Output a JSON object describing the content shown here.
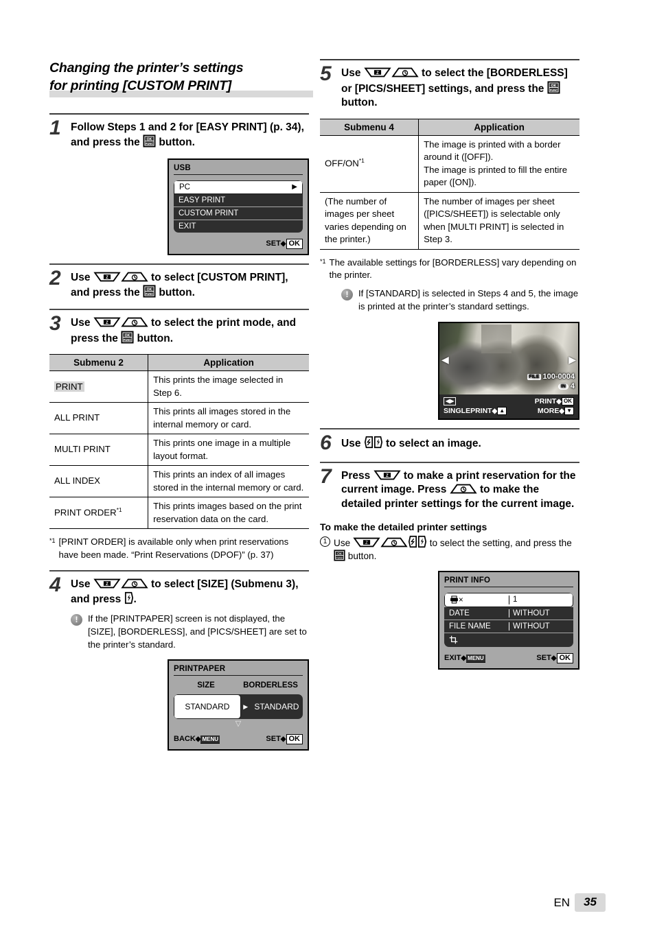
{
  "heading": {
    "line1": "Changing the printer’s settings",
    "line2": "for printing [CUSTOM PRINT]"
  },
  "steps": {
    "s1": {
      "num": "1",
      "text_a": "Follow Steps 1 and 2 for [EASY PRINT] (p. 34), and press the ",
      "text_b": " button."
    },
    "s2": {
      "num": "2",
      "text_a": "Use ",
      "text_b": " to select [CUSTOM PRINT], and press the ",
      "text_c": " button."
    },
    "s3": {
      "num": "3",
      "text_a": "Use ",
      "text_b": " to select the print mode, and press the ",
      "text_c": " button."
    },
    "s4": {
      "num": "4",
      "text_a": "Use ",
      "text_b": " to select [SIZE] (Submenu 3), and press ",
      "text_c": "."
    },
    "s5": {
      "num": "5",
      "text_a": "Use ",
      "text_b": " to select the [BORDERLESS] or [PICS/SHEET] settings, and press the ",
      "text_c": " button."
    },
    "s6": {
      "num": "6",
      "text_a": "Use ",
      "text_b": " to select an image."
    },
    "s7": {
      "num": "7",
      "text_a": "Press ",
      "text_b": " to make a print reservation for the current image. Press ",
      "text_c": " to make the detailed printer settings for the current image."
    }
  },
  "notes": {
    "step4_note": "If the [PRINTPAPER] screen is not displayed, the [SIZE], [BORDERLESS], and [PICS/SHEET] are set to the printer’s standard.",
    "step5_note": "If [STANDARD] is selected in Steps 4 and 5, the image is printed at the printer’s standard settings.",
    "bang_glyph": "!"
  },
  "footnotes": {
    "left": {
      "mark": "*1",
      "text": "[PRINT ORDER] is available only when print reservations have been made. “Print Reservations (DPOF)” (p. 37)"
    },
    "right": {
      "mark": "*1",
      "text": "The available settings for [BORDERLESS] vary depending on the printer."
    }
  },
  "table_submenu2": {
    "headers": [
      "Submenu 2",
      "Application"
    ],
    "rows": [
      {
        "name": "PRINT",
        "highlight": true,
        "app": "This prints the image selected in Step 6."
      },
      {
        "name": "ALL PRINT",
        "highlight": false,
        "app": "This prints all images stored in the internal memory or card."
      },
      {
        "name": "MULTI PRINT",
        "highlight": false,
        "app": "This prints one image in a multiple layout format."
      },
      {
        "name": "ALL INDEX",
        "highlight": false,
        "app": "This prints an index of all images stored in the internal memory or card."
      },
      {
        "name": "PRINT ORDER",
        "sup": "*1",
        "highlight": false,
        "app": "This prints images based on the print reservation data on the card."
      }
    ]
  },
  "table_submenu4": {
    "headers": [
      "Submenu 4",
      "Application"
    ],
    "rows": [
      {
        "name": "OFF/ON",
        "sup": "*1",
        "app": "The image is printed with a border around it ([OFF]).\nThe image is printed to fill the entire paper ([ON])."
      },
      {
        "name": "(The number of images per sheet varies depending on the printer.)",
        "app": "The number of images per sheet ([PICS/SHEET]) is selectable only when [MULTI PRINT] is selected in Step 3."
      }
    ]
  },
  "screen_usb": {
    "title": "USB",
    "items": [
      "PC",
      "EASY PRINT",
      "CUSTOM PRINT",
      "EXIT"
    ],
    "selected_index": 0,
    "foot_right_label": "SET",
    "foot_right_key": "OK",
    "arrow": "▶"
  },
  "screen_printpaper": {
    "title": "PRINTPAPER",
    "col1": "SIZE",
    "col2": "BORDERLESS",
    "value1": "STANDARD",
    "value2": "STANDARD",
    "foot_left_label": "BACK",
    "foot_left_key": "MENU",
    "foot_right_label": "SET",
    "foot_right_key": "OK"
  },
  "screen_photo": {
    "file_badge": "FILE",
    "file_number": "100-0004",
    "memory_badge": "IN",
    "memory_count": "4",
    "foot_left_key": "◀▶",
    "foot_left_label": "SINGLEPRINT",
    "foot_left_key2": "▲",
    "foot_right_label1": "PRINT",
    "foot_right_key1": "OK",
    "foot_right_label2": "MORE",
    "foot_right_key2": "▼"
  },
  "screen_printinfo": {
    "title": "PRINT INFO",
    "rows": [
      {
        "label": "×",
        "icon": "printer-icon",
        "value": "1",
        "selected": true
      },
      {
        "label": "DATE",
        "value": "WITHOUT",
        "selected": false
      },
      {
        "label": "FILE NAME",
        "value": "WITHOUT",
        "selected": false
      },
      {
        "label": "",
        "icon": "crop-icon",
        "value": "",
        "selected": false
      }
    ],
    "foot_left_label": "EXIT",
    "foot_left_key": "MENU",
    "foot_right_label": "SET",
    "foot_right_key": "OK"
  },
  "subsection": {
    "heading": "To make the detailed printer settings",
    "item_num": "1",
    "text_a": "Use ",
    "text_b": " to select the setting, and press the ",
    "text_c": " button."
  },
  "footer": {
    "lang": "EN",
    "page": "35"
  }
}
